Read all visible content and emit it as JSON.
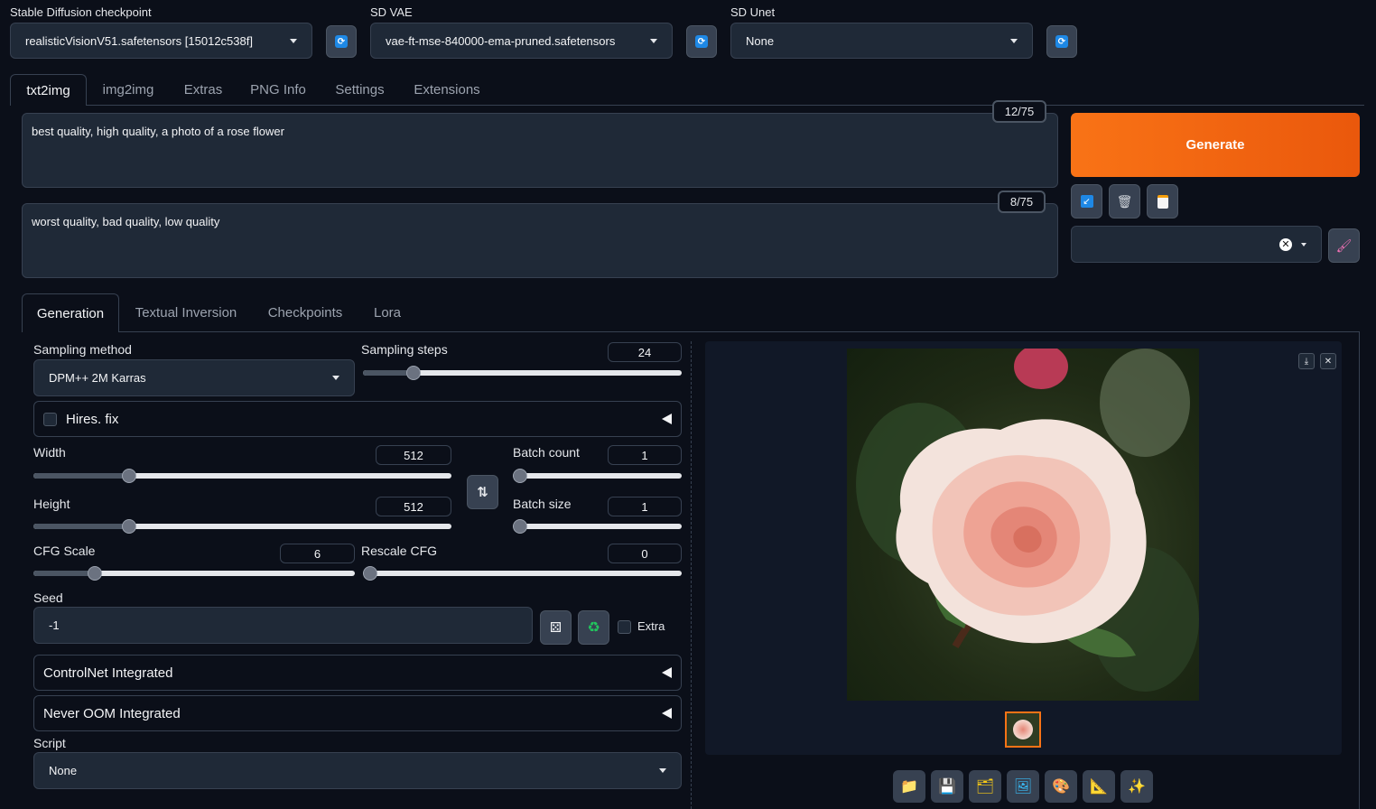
{
  "top": {
    "checkpoint_label": "Stable Diffusion checkpoint",
    "checkpoint_value": "realisticVisionV51.safetensors [15012c538f]",
    "vae_label": "SD VAE",
    "vae_value": "vae-ft-mse-840000-ema-pruned.safetensors",
    "unet_label": "SD Unet",
    "unet_value": "None"
  },
  "main_tabs": [
    "txt2img",
    "img2img",
    "Extras",
    "PNG Info",
    "Settings",
    "Extensions"
  ],
  "prompt": {
    "text": "best quality, high quality, a photo of a rose flower",
    "counter": "12/75"
  },
  "negative_prompt": {
    "text": "worst quality, bad quality, low quality",
    "counter": "8/75"
  },
  "generate_label": "Generate",
  "sub_tabs": [
    "Generation",
    "Textual Inversion",
    "Checkpoints",
    "Lora"
  ],
  "params": {
    "sampling_method_label": "Sampling method",
    "sampling_method_value": "DPM++ 2M Karras",
    "sampling_steps_label": "Sampling steps",
    "sampling_steps_value": "24",
    "hires_label": "Hires. fix",
    "width_label": "Width",
    "width_value": "512",
    "height_label": "Height",
    "height_value": "512",
    "batch_count_label": "Batch count",
    "batch_count_value": "1",
    "batch_size_label": "Batch size",
    "batch_size_value": "1",
    "cfg_label": "CFG Scale",
    "cfg_value": "6",
    "rescale_label": "Rescale CFG",
    "rescale_value": "0",
    "seed_label": "Seed",
    "seed_value": "-1",
    "extra_label": "Extra",
    "controlnet_label": "ControlNet Integrated",
    "neveroom_label": "Never OOM Integrated",
    "script_label": "Script",
    "script_value": "None"
  },
  "slider_levels": {
    "sampling_steps": 0.16,
    "width": 0.23,
    "height": 0.23,
    "batch_count": 0.0,
    "batch_size": 0.0,
    "cfg": 0.19,
    "rescale": 0.0
  },
  "icons": [
    "refresh-icon",
    "folder-icon",
    "save-icon",
    "zip-icon",
    "image-icon",
    "palette-icon",
    "ruler-icon",
    "sparkle-icon"
  ],
  "colors": {
    "accent": "#f97316",
    "bg": "#0b0f19",
    "panel": "#1f2937"
  }
}
